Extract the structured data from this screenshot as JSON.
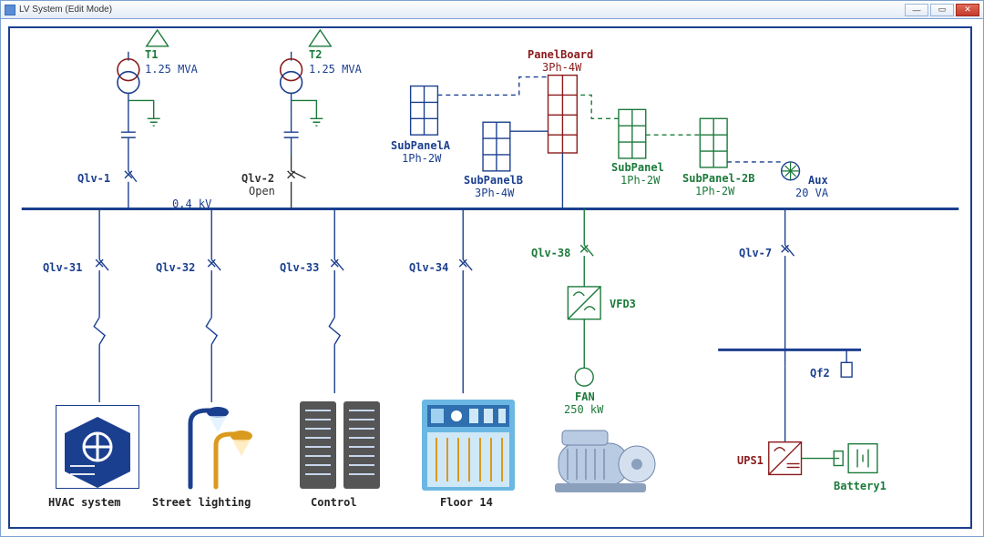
{
  "window": {
    "title": "LV System (Edit Mode)"
  },
  "bus_voltage": "0.4 kV",
  "transformers": [
    {
      "id": "T1",
      "rating": "1.25 MVA",
      "breaker": "Qlv-1"
    },
    {
      "id": "T2",
      "rating": "1.25 MVA",
      "breaker": "Qlv-2",
      "breaker_state": "Open"
    }
  ],
  "panelboard": {
    "name": "PanelBoard",
    "type": "3Ph-4W"
  },
  "subpanels": [
    {
      "name": "SubPanelA",
      "type": "1Ph-2W"
    },
    {
      "name": "SubPanelB",
      "type": "3Ph-4W"
    },
    {
      "name": "SubPanel",
      "type": "1Ph-2W"
    },
    {
      "name": "SubPanel-2B",
      "type": "1Ph-2W"
    }
  ],
  "aux": {
    "name": "Aux",
    "rating": "20 VA"
  },
  "feeders": [
    {
      "breaker": "Qlv-31",
      "load": "HVAC system"
    },
    {
      "breaker": "Qlv-32",
      "load": "Street lighting"
    },
    {
      "breaker": "Qlv-33",
      "load": "Control"
    },
    {
      "breaker": "Qlv-34",
      "load": "Floor 14"
    },
    {
      "breaker": "Qlv-38",
      "device": "VFD3",
      "motor": "FAN",
      "motor_rating": "250 kW"
    },
    {
      "breaker": "Qlv-7",
      "switch": "Qf2",
      "device": "UPS1",
      "battery": "Battery1"
    }
  ]
}
